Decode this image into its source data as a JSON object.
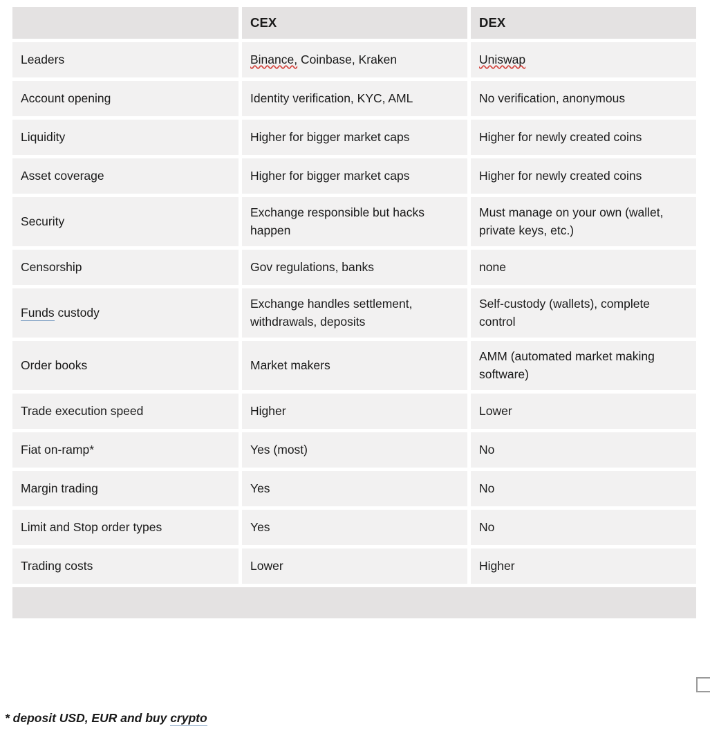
{
  "table": {
    "headers": [
      "",
      "CEX",
      "DEX"
    ],
    "rows": [
      {
        "feature": "Leaders",
        "feature_mark": "none",
        "cex": "Binance, Coinbase, Kraken",
        "cex_spell": "Binance,",
        "dex": "Uniswap",
        "dex_spell": "Uniswap"
      },
      {
        "feature": "Account opening",
        "feature_mark": "none",
        "cex": "Identity verification, KYC, AML",
        "dex": "No verification, anonymous"
      },
      {
        "feature": "Liquidity",
        "feature_mark": "none",
        "cex": "Higher for bigger market caps",
        "dex": "Higher for newly created coins"
      },
      {
        "feature": "Asset coverage",
        "feature_mark": "none",
        "cex": "Higher for bigger market caps",
        "dex": "Higher for newly created coins"
      },
      {
        "feature": "Security",
        "feature_mark": "none",
        "cex": "Exchange responsible but hacks happen",
        "dex": "Must manage on your own (wallet, private keys, etc.)"
      },
      {
        "feature": "Censorship",
        "feature_mark": "none",
        "cex": "Gov regulations, banks",
        "dex": "none"
      },
      {
        "feature": "Funds custody",
        "feature_mark": "grammar",
        "feature_marked_word": "Funds",
        "feature_rest": " custody",
        "cex": "Exchange handles settlement, withdrawals, deposits",
        "dex": "Self-custody (wallets), complete control"
      },
      {
        "feature": "Order books",
        "feature_mark": "none",
        "cex": "Market makers",
        "dex": "AMM (automated market making software)"
      },
      {
        "feature": "Trade execution speed",
        "feature_mark": "none",
        "cex": "Higher",
        "dex": "Lower"
      },
      {
        "feature": "Fiat on-ramp*",
        "feature_mark": "none",
        "cex": "Yes (most)",
        "dex": "No"
      },
      {
        "feature": "Margin trading",
        "feature_mark": "none",
        "cex": "Yes",
        "dex": "No"
      },
      {
        "feature": "Limit and Stop order types",
        "feature_mark": "none",
        "cex": "Yes",
        "dex": "No"
      },
      {
        "feature": "Trading costs",
        "feature_mark": "none",
        "cex": "Lower",
        "dex": "Higher"
      }
    ],
    "footer_row": {
      "feature": "",
      "cex": "",
      "dex": ""
    }
  },
  "footnote": {
    "prefix": "* deposit USD, EUR and buy ",
    "link_word": "crypto"
  },
  "colors": {
    "header_bg": "#e4e2e2",
    "cell_bg": "#f2f1f1",
    "page_bg": "#ffffff",
    "text": "#1a1a1a",
    "spell_error": "#d4453f",
    "grammar_mark": "#8aa8c8",
    "link_underline": "#7a9cc0",
    "edge_box_border": "#9a9a9a"
  }
}
